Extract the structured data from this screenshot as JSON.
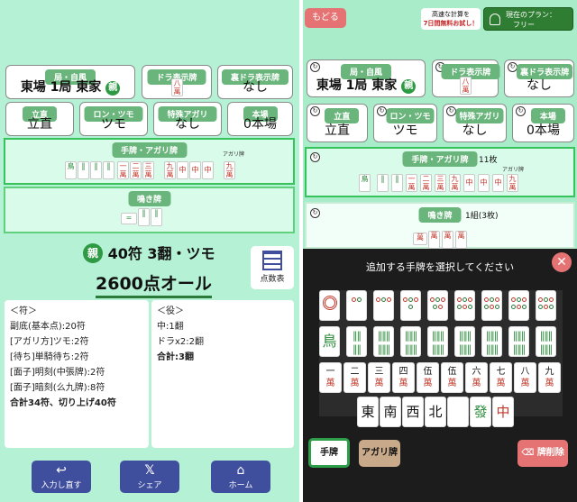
{
  "left": {
    "kyoku_label": "局・自風",
    "kyoku_value": "東場 1局 東家",
    "oya_badge": "親",
    "dora_label": "ドラ表示牌",
    "uradora_label": "裏ドラ表示牌",
    "uradora_value": "なし",
    "riichi_label": "立直",
    "riichi_value": "立直",
    "ron_label": "ロン・ツモ",
    "ron_value": "ツモ",
    "tokushu_label": "特殊アガリ",
    "tokushu_value": "なし",
    "honba_label": "本場",
    "honba_value": "0本場",
    "hand_label": "手牌・アガリ牌",
    "agari_caption": "アガリ牌",
    "naki_label": "鳴き牌",
    "result_fu_han": "40符 3翻・ツモ",
    "result_points": "2600点オール",
    "tensuu_button": "点数表",
    "fu_header": "＜符＞",
    "fu_lines": [
      "副底(基本点):20符",
      "[アガリ方]ツモ:2符",
      "[待ち]単騎待ち:2符",
      "[面子]明刻(中張牌):2符",
      "[面子]暗刻(么九牌):8符",
      "合計34符、切り上げ40符"
    ],
    "yaku_header": "＜役＞",
    "yaku_lines": [
      "中:1翻",
      "ドラx2:2翻",
      "合計:3翻"
    ],
    "btn_retry": "入力し直す",
    "btn_share": "シェア",
    "btn_home": "ホーム"
  },
  "right": {
    "back_button": "もどる",
    "promo_line1": "高速な計算を",
    "promo_line2": "7日間無料お試し！",
    "plan_line1": "現在のプラン：",
    "plan_line2": "フリー",
    "kyoku_label": "局・自風",
    "kyoku_value": "東場 1局 東家",
    "oya_badge": "親",
    "dora_label": "ドラ表示牌",
    "uradora_label": "裏ドラ表示牌",
    "uradora_value": "なし",
    "riichi_label": "立直",
    "riichi_value": "立直",
    "ron_label": "ロン・ツモ",
    "ron_value": "ツモ",
    "tokushu_label": "特殊アガリ",
    "tokushu_value": "なし",
    "honba_label": "本場",
    "honba_value": "0本場",
    "hand_label": "手牌・アガリ牌",
    "hand_count": "11枚",
    "agari_caption": "アガリ牌",
    "naki_label": "鳴き牌",
    "naki_count": "1組(3枚)",
    "overlay_title": "追加する手牌を選択してください",
    "tab_tehai": "手牌",
    "tab_agari": "アガリ牌",
    "delete_button": "牌削除",
    "man_row": [
      "一",
      "二",
      "三",
      "四",
      "伍",
      "伍",
      "六",
      "七",
      "八",
      "九"
    ],
    "man_suffix": "萬",
    "honor_row": [
      "東",
      "南",
      "西",
      "北",
      "",
      "發",
      "中"
    ]
  },
  "colors": {
    "green_accent": "#38c25c",
    "badge_green": "#6ab57c",
    "navy": "#3f4f9e",
    "red_back": "#e57373"
  }
}
